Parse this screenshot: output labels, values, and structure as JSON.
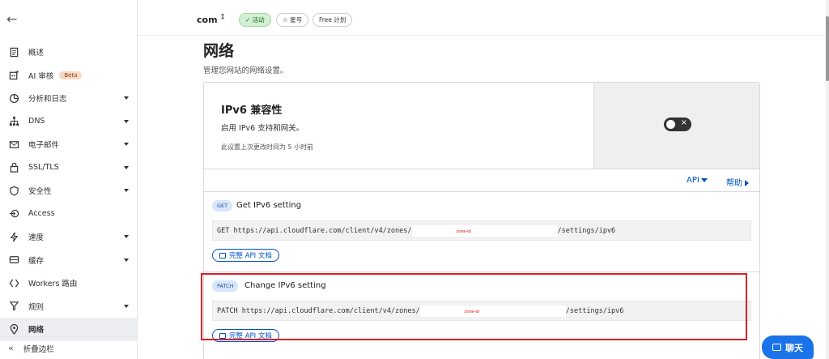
{
  "nav": {
    "items": [
      {
        "label": "概述",
        "icon": "document-icon",
        "caret": false
      },
      {
        "label": "AI 审核",
        "icon": "ai-audit-icon",
        "caret": false,
        "badge": "Beta"
      },
      {
        "label": "分析和日志",
        "icon": "chart-icon",
        "caret": true
      },
      {
        "label": "DNS",
        "icon": "sitemap-icon",
        "caret": true
      },
      {
        "label": "电子邮件",
        "icon": "mail-icon",
        "caret": true
      },
      {
        "label": "SSL/TLS",
        "icon": "lock-icon",
        "caret": true
      },
      {
        "label": "安全性",
        "icon": "shield-icon",
        "caret": true
      },
      {
        "label": "Access",
        "icon": "access-icon",
        "caret": false
      },
      {
        "label": "速度",
        "icon": "lightning-icon",
        "caret": true
      },
      {
        "label": "缓存",
        "icon": "cache-icon",
        "caret": true
      },
      {
        "label": "Workers 路由",
        "icon": "workers-icon",
        "caret": false
      },
      {
        "label": "规则",
        "icon": "rules-icon",
        "caret": true
      },
      {
        "label": "网络",
        "icon": "location-pin-icon",
        "caret": false,
        "active": true
      }
    ],
    "collapse_label": "折叠边栏"
  },
  "header": {
    "domain": "com",
    "status": "活动",
    "star": "星号",
    "plan": "Free 计划"
  },
  "main": {
    "title": "网络",
    "description": "管理您网站的网络设置。"
  },
  "setting": {
    "title": "IPv6 兼容性",
    "description": "启用 IPv6 支持和网关。",
    "modified": "此设置上次更改时间为 5 小时前",
    "enabled": false
  },
  "links": {
    "api": "API",
    "help": "帮助"
  },
  "api_get": {
    "method": "GET",
    "name": "Get IPv6 setting",
    "endpoint_prefix": "GET https://api.cloudflare.com/client/v4/zones/",
    "redacted_label": "zone-id",
    "endpoint_suffix": "/settings/ipv6",
    "doc_label": "完整 API 文档"
  },
  "api_patch": {
    "method": "PATCH",
    "name": "Change IPv6 setting",
    "endpoint_prefix": "PATCH https://api.cloudflare.com/client/v4/zones/",
    "redacted_label": "zone-id",
    "endpoint_suffix": "/settings/ipv6",
    "doc_label": "完整 API 文档"
  },
  "chat": {
    "label": "聊天"
  },
  "colors": {
    "accent": "#0051c3",
    "highlight": "#d8202a",
    "chat": "#1a73e8"
  }
}
